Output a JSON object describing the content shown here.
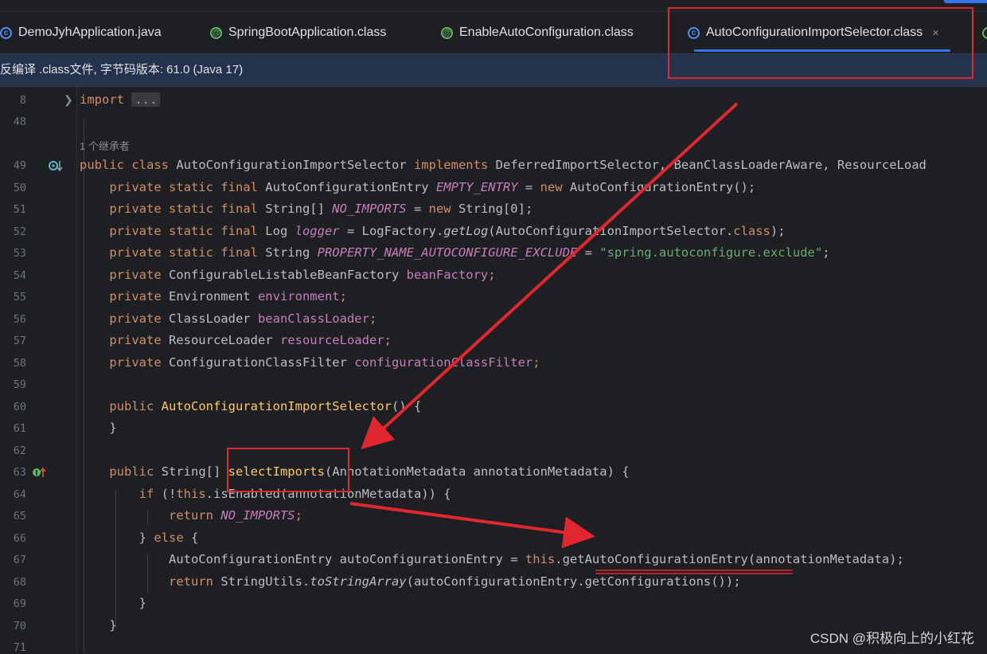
{
  "tabs": [
    {
      "label": "DemoJyhApplication.java",
      "icon": "java-class-icon"
    },
    {
      "label": "SpringBootApplication.class",
      "icon": "annotation-icon"
    },
    {
      "label": "EnableAutoConfiguration.class",
      "icon": "annotation-icon"
    },
    {
      "label": "AutoConfigurationImportSelector.class",
      "icon": "class-icon",
      "active": true,
      "close": "×"
    }
  ],
  "infobar": {
    "text": "反编译 .class文件, 字节码版本: 61.0 (Java 17)"
  },
  "editor": {
    "inheritors_hint": "1 个继承者",
    "line_numbers": [
      "8",
      "48",
      "49",
      "50",
      "51",
      "52",
      "53",
      "54",
      "55",
      "56",
      "57",
      "58",
      "59",
      "60",
      "61",
      "62",
      "63",
      "64",
      "65",
      "66",
      "67",
      "68",
      "69",
      "70",
      "71"
    ],
    "code": {
      "l8_kw": "import",
      "l8_fold": "...",
      "l49_a": "public class ",
      "l49_b": "AutoConfigurationImportSelector ",
      "l49_c": "implements ",
      "l49_d": "DeferredImportSelector, BeanClassLoaderAware, ResourceLoad",
      "pss": "private static final ",
      "p": "private ",
      "l50_t": "AutoConfigurationEntry ",
      "l50_f": "EMPTY_ENTRY",
      "l50_e": " = ",
      "l50_n": "new ",
      "l50_r": "AutoConfigurationEntry();",
      "l51_t": "String[] ",
      "l51_f": "NO_IMPORTS",
      "l51_e": " = ",
      "l51_n": "new ",
      "l51_r": "String[0];",
      "l52_t": "Log ",
      "l52_f": "logger",
      "l52_e": " = LogFactory.",
      "l52_m": "getLog",
      "l52_a": "(AutoConfigurationImportSelector.",
      "l52_c": "class",
      "l52_z": ");",
      "l53_t": "String ",
      "l53_f": "PROPERTY_NAME_AUTOCONFIGURE_EXCLUDE",
      "l53_e": " = ",
      "l53_s": "\"spring.autoconfigure.exclude\"",
      "l53_z": ";",
      "l54_t": "ConfigurableListableBeanFactory ",
      "l54_f": "beanFactory",
      "l55_t": "Environment ",
      "l55_f": "environment",
      "l56_t": "ClassLoader ",
      "l56_f": "beanClassLoader",
      "l57_t": "ResourceLoader ",
      "l57_f": "resourceLoader",
      "l58_t": "ConfigurationClassFilter ",
      "l58_f": "configurationClassFilter",
      "semi": ";",
      "l60_a": "public ",
      "l60_b": "AutoConfigurationImportSelector",
      "l60_c": "() {",
      "brace": "}",
      "l63_a": "public ",
      "l63_b": "String[] ",
      "l63_c": "selectImports",
      "l63_d": "(AnnotationMetadata annotationMetadata) {",
      "l64_a": "if ",
      "l64_b": "(!",
      "l64_c": "this",
      "l64_d": ".isEnabled(annotationMetadata)) {",
      "l65_a": "return ",
      "l65_b": "NO_IMPORTS",
      "l65_c": ";",
      "l66_a": "} ",
      "l66_b": "else ",
      "l66_c": "{",
      "l67_a": "AutoConfigurationEntry autoConfigurationEntry = ",
      "l67_b": "this",
      "l67_c": ".getAutoConfigurationEntry(annotationMetadata);",
      "l68_a": "return ",
      "l68_b": "StringUtils.",
      "l68_c": "toStringArray",
      "l68_d": "(autoConfigurationEntry.getConfigurations());"
    }
  },
  "watermark": "CSDN @积极向上的小红花",
  "colors": {
    "annotation_red": "#e0262f",
    "accent": "#3574f0"
  }
}
